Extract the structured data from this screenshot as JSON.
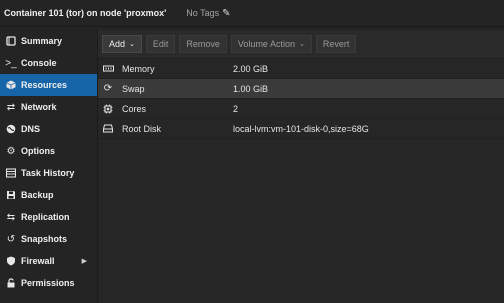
{
  "header": {
    "title": "Container 101 (tor) on node 'proxmox'",
    "tags": "No Tags"
  },
  "sidebar": {
    "items": [
      {
        "label": "Summary",
        "icon": "book-icon",
        "active": false
      },
      {
        "label": "Console",
        "icon": "terminal-icon",
        "active": false
      },
      {
        "label": "Resources",
        "icon": "cube-icon",
        "active": true
      },
      {
        "label": "Network",
        "icon": "exchange-icon",
        "active": false
      },
      {
        "label": "DNS",
        "icon": "globe-icon",
        "active": false
      },
      {
        "label": "Options",
        "icon": "gear-icon",
        "active": false
      },
      {
        "label": "Task History",
        "icon": "list-icon",
        "active": false
      },
      {
        "label": "Backup",
        "icon": "floppy-icon",
        "active": false
      },
      {
        "label": "Replication",
        "icon": "retweet-icon",
        "active": false
      },
      {
        "label": "Snapshots",
        "icon": "history-icon",
        "active": false
      },
      {
        "label": "Firewall",
        "icon": "shield-icon",
        "active": false
      },
      {
        "label": "Permissions",
        "icon": "unlock-icon",
        "active": false
      }
    ]
  },
  "toolbar": {
    "add_label": "Add",
    "edit_label": "Edit",
    "remove_label": "Remove",
    "volume_action_label": "Volume Action",
    "revert_label": "Revert"
  },
  "resources": [
    {
      "key": "Memory",
      "value": "2.00 GiB",
      "icon": "memory-icon"
    },
    {
      "key": "Swap",
      "value": "1.00 GiB",
      "icon": "refresh-icon"
    },
    {
      "key": "Cores",
      "value": "2",
      "icon": "cpu-icon"
    },
    {
      "key": "Root Disk",
      "value": "local-lvm:vm-101-disk-0,size=68G",
      "icon": "hdd-icon"
    }
  ]
}
